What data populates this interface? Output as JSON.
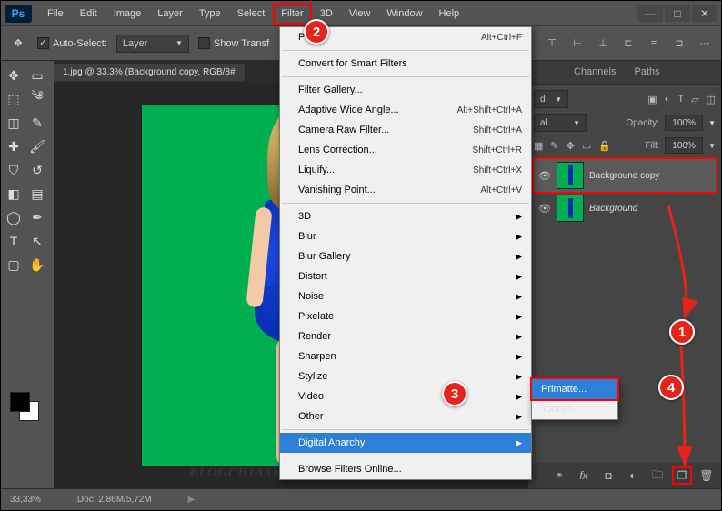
{
  "app": {
    "logo": "Ps"
  },
  "menubar": [
    "File",
    "Edit",
    "Image",
    "Layer",
    "Type",
    "Select",
    "Filter",
    "3D",
    "View",
    "Window",
    "Help"
  ],
  "options": {
    "auto_select_label": "Auto-Select:",
    "auto_select_dd": "Layer",
    "show_transform": "Show Transf"
  },
  "doc_tab": "1.jpg @ 33,3% (Background copy, RGB/8#",
  "watermark": "BLOGCHIASEKIENTHUC.COM",
  "filter_menu": {
    "recent": {
      "label": "Pr",
      "shortcut": "Alt+Ctrl+F"
    },
    "convert": "Convert for Smart Filters",
    "gallery": "Filter Gallery...",
    "adaptive": {
      "label": "Adaptive Wide Angle...",
      "shortcut": "Alt+Shift+Ctrl+A"
    },
    "camera_raw": {
      "label": "Camera Raw Filter...",
      "shortcut": "Shift+Ctrl+A"
    },
    "lens": {
      "label": "Lens Correction...",
      "shortcut": "Shift+Ctrl+R"
    },
    "liquify": {
      "label": "Liquify...",
      "shortcut": "Shift+Ctrl+X"
    },
    "vanish": {
      "label": "Vanishing Point...",
      "shortcut": "Alt+Ctrl+V"
    },
    "subs": [
      "3D",
      "Blur",
      "Blur Gallery",
      "Distort",
      "Noise",
      "Pixelate",
      "Render",
      "Sharpen",
      "Stylize",
      "Video",
      "Other"
    ],
    "digital_anarchy": "Digital Anarchy",
    "browse": "Browse Filters Online..."
  },
  "submenu": {
    "primatte": "Primatte...",
    "toonit": "ToonIt!..."
  },
  "panels": {
    "tabs": [
      "Channels",
      "Paths"
    ],
    "kind_dd": "d",
    "blend_dd": "al",
    "opacity_label": "Opacity:",
    "opacity_value": "100%",
    "lock_label": "Lock:",
    "fill_label": "Fill:",
    "fill_value": "100%",
    "layers": [
      {
        "name": "Background copy",
        "selected": true,
        "italic": false
      },
      {
        "name": "Background",
        "selected": false,
        "italic": true
      }
    ]
  },
  "statusbar": {
    "zoom": "33,33%",
    "doc": "Doc:  2,86M/5,72M"
  },
  "badges": {
    "b1": "1",
    "b2": "2",
    "b3": "3",
    "b4": "4"
  }
}
